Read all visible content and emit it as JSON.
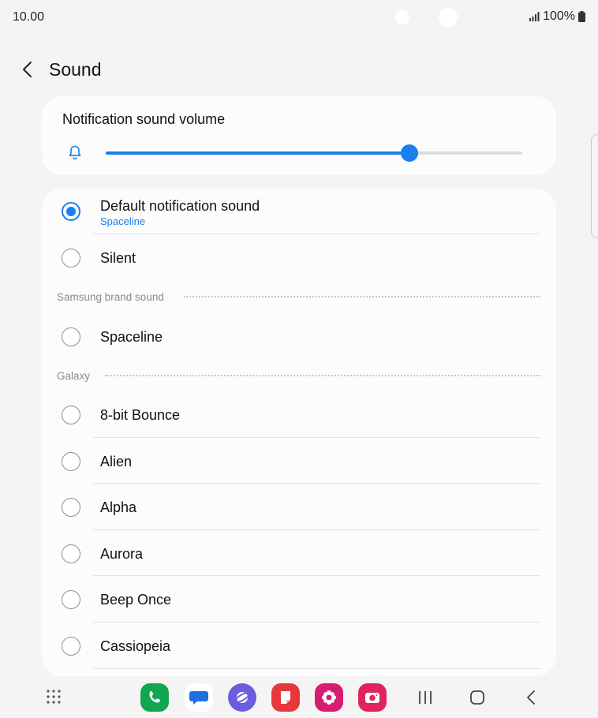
{
  "status": {
    "time": "10.00",
    "battery": "100%"
  },
  "header": {
    "title": "Sound"
  },
  "volume": {
    "title": "Notification sound volume",
    "level": 0.73
  },
  "colors": {
    "accent": "#1a7df0",
    "background": "#f4f4f4",
    "card": "#fcfcfc"
  },
  "options": {
    "default": {
      "label": "Default notification sound",
      "sub": "Spaceline",
      "selected": true
    },
    "silent": {
      "label": "Silent"
    }
  },
  "sections": {
    "samsung": {
      "label": "Samsung brand sound",
      "items": [
        "Spaceline"
      ]
    },
    "galaxy": {
      "label": "Galaxy",
      "items": [
        "8-bit Bounce",
        "Alien",
        "Alpha",
        "Aurora",
        "Beep Once",
        "Cassiopeia"
      ]
    }
  },
  "dock": {
    "apps": [
      {
        "name": "phone-app-icon",
        "color": "#12a651"
      },
      {
        "name": "messages-app-icon",
        "color": "#ffffff"
      },
      {
        "name": "internet-app-icon",
        "color": "#6b5de0"
      },
      {
        "name": "notes-app-icon",
        "color": "#e5383b"
      },
      {
        "name": "gallery-app-icon",
        "color": "#d81b73"
      },
      {
        "name": "camera-app-icon",
        "color": "#e0245e"
      }
    ]
  }
}
